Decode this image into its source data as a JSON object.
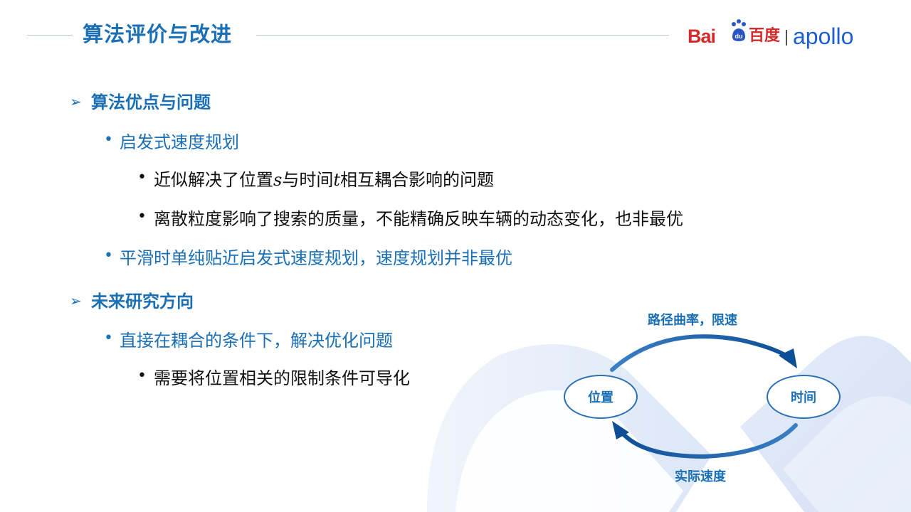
{
  "slide_title": "算法评价与改进",
  "logo": {
    "baidu_latin": "Bai",
    "baidu_cn": "百度",
    "product": "apollo"
  },
  "bullets": [
    {
      "level": 1,
      "text": "算法优点与问题"
    },
    {
      "level": 2,
      "text": "启发式速度规划"
    },
    {
      "level": 3,
      "text_before": "近似解决了位置",
      "var1": "s",
      "text_mid": "与时间",
      "var2": "t",
      "text_after": "相互耦合影响的问题"
    },
    {
      "level": 3,
      "text": "离散粒度影响了搜索的质量，不能精确反映车辆的动态变化，也非最优"
    },
    {
      "level": 2,
      "text": "平滑时单纯贴近启发式速度规划，速度规划并非最优"
    },
    {
      "level": 1,
      "text": "未来研究方向"
    },
    {
      "level": 2,
      "text": "直接在耦合的条件下，解决优化问题"
    },
    {
      "level": 3,
      "text": "需要将位置相关的限制条件可导化"
    }
  ],
  "diagram": {
    "top_label": "路径曲率，限速",
    "bottom_label": "实际速度",
    "left_node": "位置",
    "right_node": "时间"
  },
  "colors": {
    "accent": "#1a6fb5",
    "body_text": "#111111",
    "baidu_red": "#d32b2b",
    "apollo_blue": "#1d5fd0"
  }
}
